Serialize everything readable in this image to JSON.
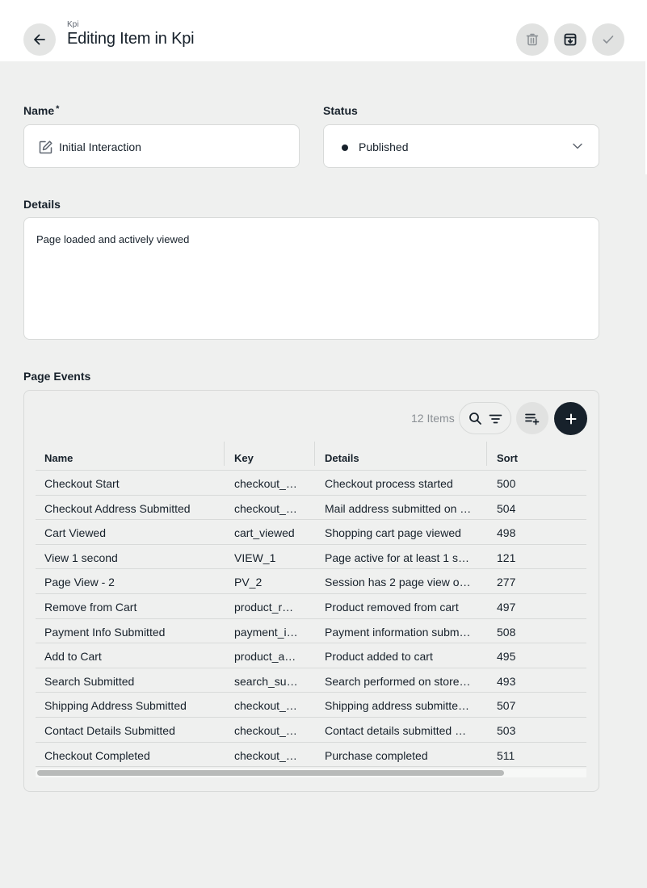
{
  "header": {
    "breadcrumb": "Kpi",
    "title": "Editing Item in Kpi",
    "icons": {
      "back": "arrow-left-icon",
      "delete": "trash-icon",
      "archive": "archive-icon",
      "save": "check-icon"
    }
  },
  "form": {
    "name_label": "Name",
    "name_required": "*",
    "name_value": "Initial Interaction",
    "status_label": "Status",
    "status_value": "Published",
    "details_label": "Details",
    "details_value": "Page loaded and actively viewed"
  },
  "events": {
    "label": "Page Events",
    "count_text": "12 Items",
    "columns": [
      "Name",
      "Key",
      "Details",
      "Sort"
    ],
    "rows": [
      [
        "Checkout Start",
        "checkout_…",
        "Checkout process started",
        "500"
      ],
      [
        "Checkout Address Submitted",
        "checkout_…",
        "Mail address submitted on …",
        "504"
      ],
      [
        "Cart Viewed",
        "cart_viewed",
        "Shopping cart page viewed",
        "498"
      ],
      [
        "View 1 second",
        "VIEW_1",
        "Page active for at least 1 se…",
        "121"
      ],
      [
        "Page View - 2",
        "PV_2",
        "Session has 2 page view or…",
        "277"
      ],
      [
        "Remove from Cart",
        "product_re…",
        "Product removed from cart",
        "497"
      ],
      [
        "Payment Info Submitted",
        "payment_i…",
        "Payment information subm…",
        "508"
      ],
      [
        "Add to Cart",
        "product_a…",
        "Product added to cart",
        "495"
      ],
      [
        "Search Submitted",
        "search_su…",
        "Search performed on store…",
        "493"
      ],
      [
        "Shipping Address Submitted",
        "checkout_…",
        "Shipping address submitte…",
        "507"
      ],
      [
        "Contact Details Submitted",
        "checkout_…",
        "Contact details submitted …",
        "503"
      ],
      [
        "Checkout Completed",
        "checkout_…",
        "Purchase completed",
        "511"
      ]
    ]
  },
  "colors": {
    "accent": "#17212b",
    "background": "#eff0ef",
    "surface": "#ffffff",
    "border": "#d8dad9"
  }
}
